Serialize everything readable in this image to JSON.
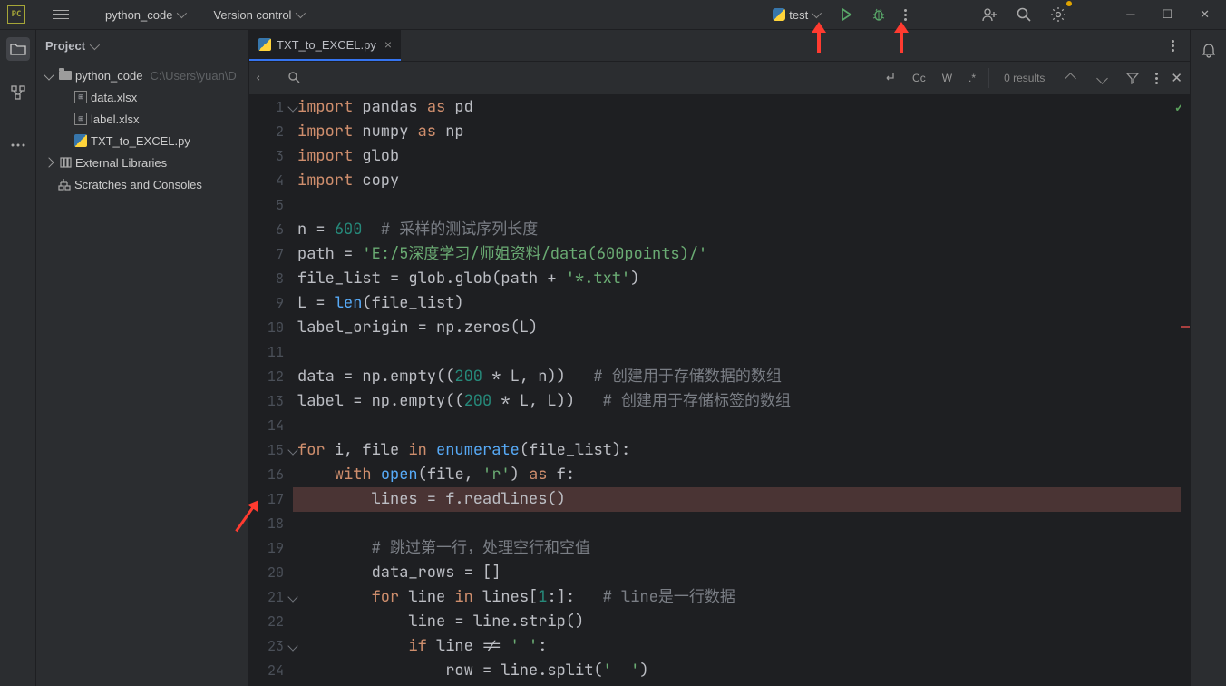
{
  "title_bar": {
    "project_name": "python_code",
    "vcs_label": "Version control",
    "run_config": "test"
  },
  "sidebar": {
    "header": "Project",
    "root_folder": "python_code",
    "root_path": "C:\\Users\\yuan\\D",
    "files": [
      {
        "name": "data.xlsx",
        "type": "xlsx"
      },
      {
        "name": "label.xlsx",
        "type": "xlsx"
      },
      {
        "name": "TXT_to_EXCEL.py",
        "type": "py"
      }
    ],
    "external_libs": "External Libraries",
    "scratches": "Scratches and Consoles"
  },
  "tab": {
    "label": "TXT_to_EXCEL.py"
  },
  "find": {
    "placeholder": "",
    "results": "0 results",
    "cc": "Cc",
    "w": "W",
    "regex": ".*"
  },
  "code_lines": [
    {
      "n": 1,
      "exp": true
    },
    {
      "n": 2
    },
    {
      "n": 3
    },
    {
      "n": 4
    },
    {
      "n": 5
    },
    {
      "n": 6
    },
    {
      "n": 7
    },
    {
      "n": 8
    },
    {
      "n": 9
    },
    {
      "n": 10
    },
    {
      "n": 11
    },
    {
      "n": 12
    },
    {
      "n": 13
    },
    {
      "n": 14
    },
    {
      "n": 15,
      "exp": true
    },
    {
      "n": 16
    },
    {
      "n": 17,
      "bp": true
    },
    {
      "n": 18
    },
    {
      "n": 19
    },
    {
      "n": 20
    },
    {
      "n": 21,
      "exp": true
    },
    {
      "n": 22
    },
    {
      "n": 23,
      "exp": true
    },
    {
      "n": 24
    }
  ],
  "code_text": {
    "l1": [
      "import",
      " pandas ",
      "as",
      " pd"
    ],
    "l2": [
      "import",
      " numpy ",
      "as",
      " np"
    ],
    "l3": [
      "import",
      " glob"
    ],
    "l4": [
      "import",
      " copy"
    ],
    "l5": "",
    "l6_a": "n = ",
    "l6_n": "600",
    "l6_c": "  # 采样的测试序列长度",
    "l7_a": "path = ",
    "l7_s": "'E:/5深度学习/师姐资料/data(600points)/'",
    "l8_a": "file_list = glob.glob(path + ",
    "l8_s": "'*.txt'",
    "l8_b": ")",
    "l9_a": "L = ",
    "l9_f": "len",
    "l9_b": "(file_list)",
    "l10": "label_origin = np.zeros(L)",
    "l11": "",
    "l12_a": "data = np.empty((",
    "l12_n": "200",
    "l12_b": " * L, n))",
    "l12_c": "   # 创建用于存储数据的数组",
    "l13_a": "label = np.empty((",
    "l13_n": "200",
    "l13_b": " * L, L))",
    "l13_c": "   # 创建用于存储标签的数组",
    "l14": "",
    "l15_a": "for",
    "l15_b": " i, file ",
    "l15_c": "in",
    "l15_d": " ",
    "l15_f": "enumerate",
    "l15_e": "(file_list):",
    "l16_a": "    ",
    "l16_w": "with",
    "l16_b": " ",
    "l16_f": "open",
    "l16_c": "(file, ",
    "l16_s": "'r'",
    "l16_d": ") ",
    "l16_as": "as",
    "l16_e": " f:",
    "l17": "        lines = f.readlines()",
    "l18": "",
    "l19_c": "        # 跳过第一行，处理空行和空值",
    "l20": "        data_rows = []",
    "l21_a": "        ",
    "l21_for": "for",
    "l21_b": " line ",
    "l21_in": "in",
    "l21_c": " lines[",
    "l21_n": "1",
    "l21_d": ":]:",
    "l21_cm": "   # line是一行数据",
    "l22": "            line = line.strip()",
    "l23_a": "            ",
    "l23_if": "if",
    "l23_b": " line != ",
    "l23_s": "' '",
    "l23_c": ":",
    "l24_a": "                row = line.split(",
    "l24_s": "'  '",
    "l24_b": ")"
  }
}
